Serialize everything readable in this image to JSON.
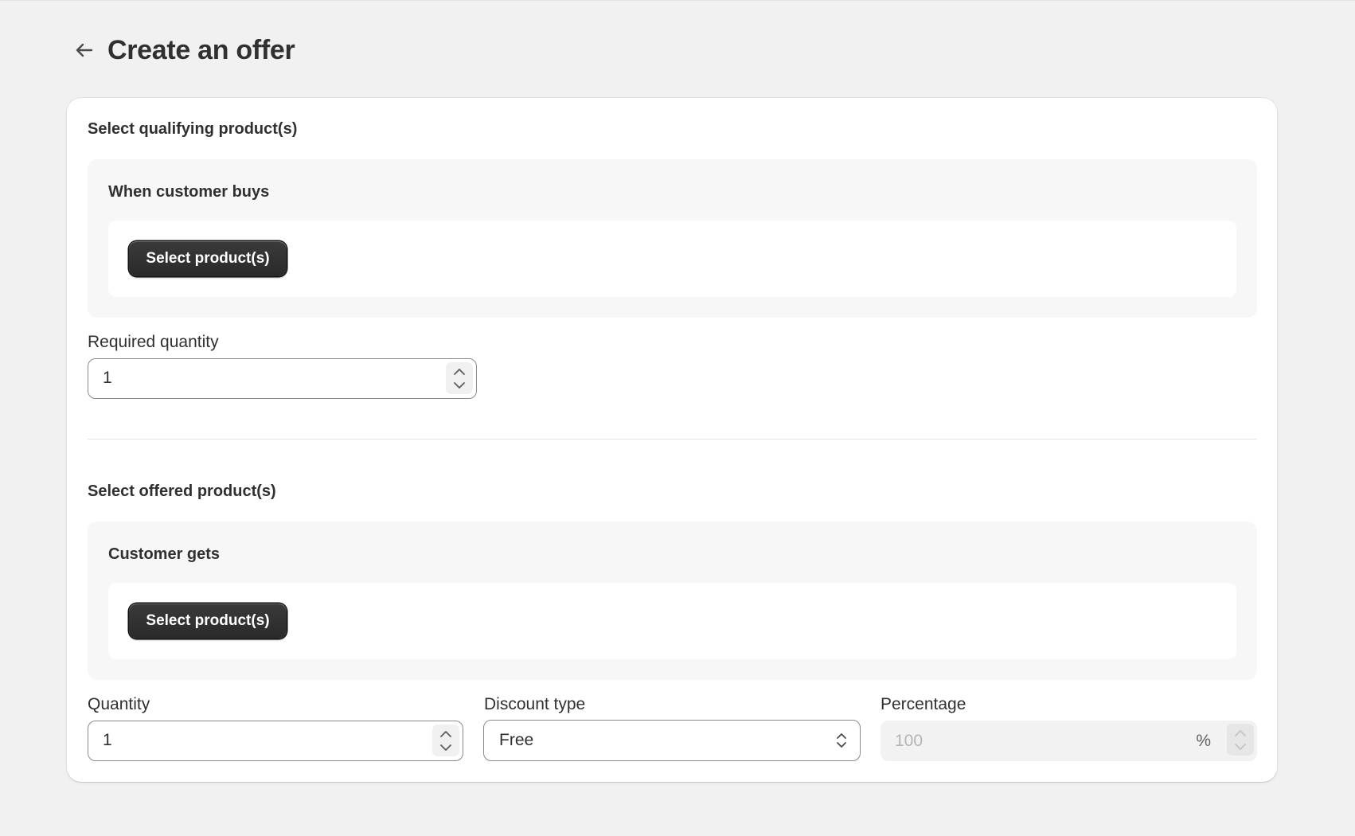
{
  "page": {
    "title": "Create an offer"
  },
  "qualifying": {
    "heading": "Select qualifying product(s)",
    "group_title": "When customer buys",
    "select_button": "Select product(s)",
    "quantity_label": "Required quantity",
    "quantity_value": "1"
  },
  "offered": {
    "heading": "Select offered product(s)",
    "group_title": "Customer gets",
    "select_button": "Select product(s)",
    "quantity_label": "Quantity",
    "quantity_value": "1",
    "discount_type_label": "Discount type",
    "discount_type_value": "Free",
    "percentage_label": "Percentage",
    "percentage_value": "100",
    "percentage_suffix": "%"
  },
  "icons": {
    "back": "arrow-left-icon",
    "stepper_up": "chevron-up-icon",
    "stepper_down": "chevron-down-icon",
    "select": "select-arrows-icon"
  },
  "colors": {
    "page_bg": "#f1f1f1",
    "card_bg": "#ffffff",
    "primary_button": "#303030",
    "text": "#303030",
    "disabled_text": "#b5b5b5"
  }
}
